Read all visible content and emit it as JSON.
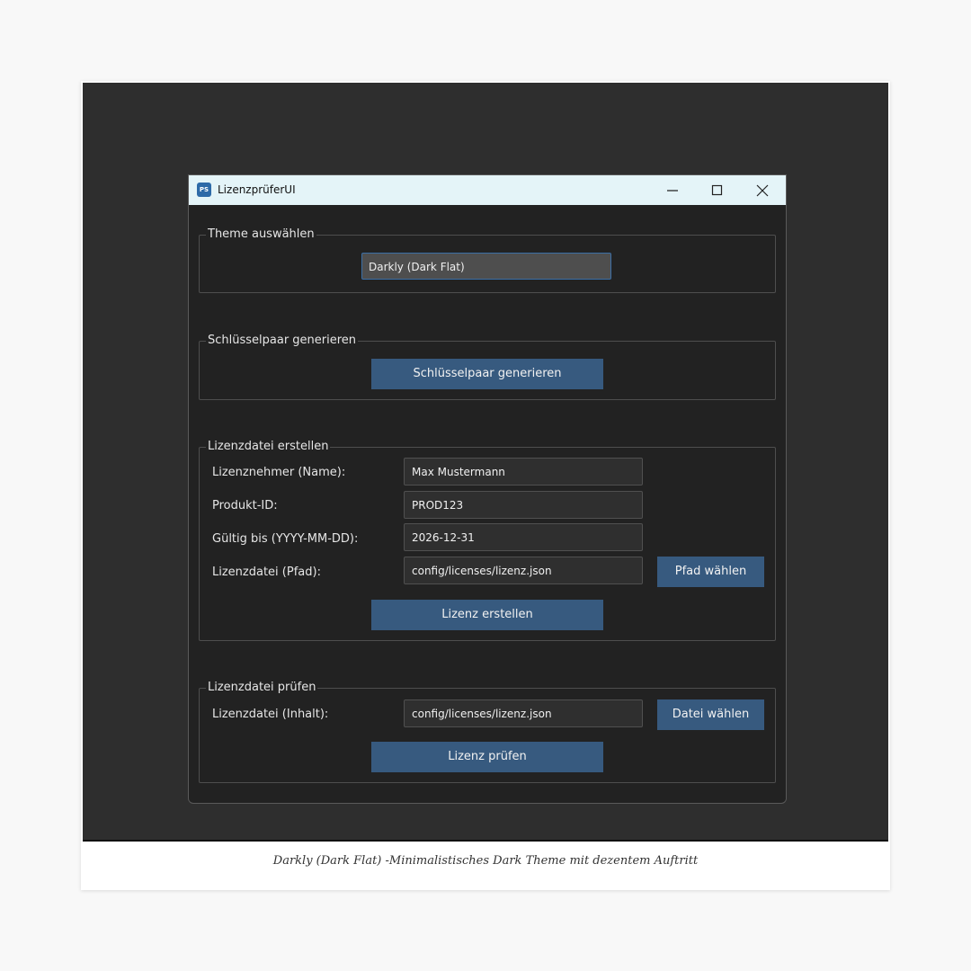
{
  "window": {
    "title": "LizenzprüferUI",
    "icon_text": "PS"
  },
  "theme_group": {
    "label": "Theme auswählen",
    "selected_theme": "Darkly (Dark Flat)"
  },
  "keypair_group": {
    "label": "Schlüsselpaar generieren",
    "button": "Schlüsselpaar generieren"
  },
  "create_group": {
    "label": "Lizenzdatei erstellen",
    "fields": [
      {
        "label": "Lizenznehmer (Name):",
        "value": "Max Mustermann"
      },
      {
        "label": "Produkt-ID:",
        "value": "PROD123"
      },
      {
        "label": "Gültig bis (YYYY-MM-DD):",
        "value": "2026-12-31"
      },
      {
        "label": "Lizenzdatei (Pfad):",
        "value": "config/licenses/lizenz.json"
      }
    ],
    "browse_button": "Pfad wählen",
    "create_button": "Lizenz erstellen"
  },
  "check_group": {
    "label": "Lizenzdatei prüfen",
    "field_label": "Lizenzdatei (Inhalt):",
    "field_value": "config/licenses/lizenz.json",
    "browse_button": "Datei wählen",
    "check_button": "Lizenz prüfen"
  },
  "caption": "Darkly (Dark Flat) -Minimalistisches Dark Theme mit dezentem Auftritt",
  "colors": {
    "accent_button": "#375a7f",
    "window_bg": "#222222",
    "titlebar_bg": "#e4f4f8",
    "focus_border": "#3b6ea5"
  },
  "icons": [
    "app-icon",
    "minimize-icon",
    "maximize-icon",
    "close-icon"
  ]
}
